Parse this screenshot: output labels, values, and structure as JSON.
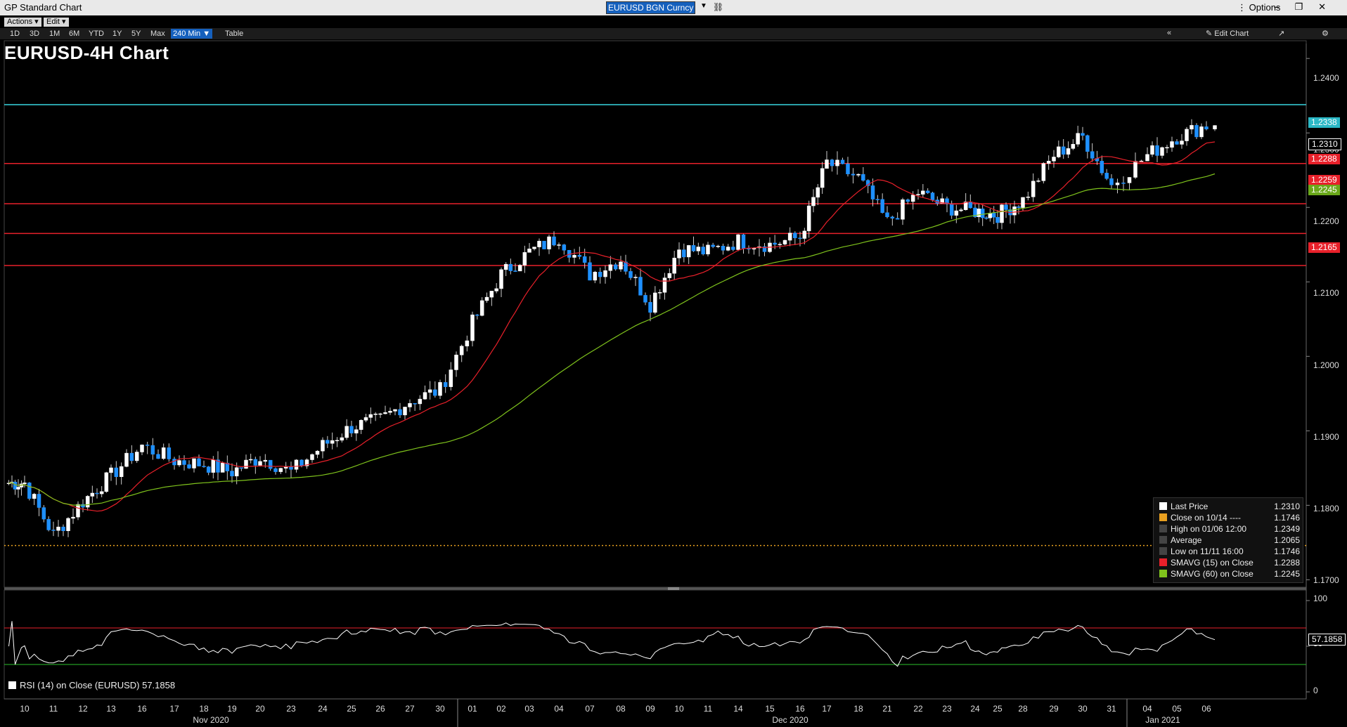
{
  "window": {
    "title": "GP Standard Chart",
    "ticker": "EURUSD BGN Curncy",
    "options_label": "Options"
  },
  "menubar": {
    "actions": "Actions",
    "edit": "Edit"
  },
  "toolbar": {
    "timeframes": [
      "1D",
      "3D",
      "1M",
      "6M",
      "YTD",
      "1Y",
      "5Y",
      "Max",
      "240 Min"
    ],
    "active_timeframe": "240 Min",
    "table": "Table",
    "edit_chart": "Edit Chart"
  },
  "chart_title": "EURUSD-4H Chart",
  "colors": {
    "up": "#ffffff",
    "down": "#1e90ff",
    "sma15": "#e8202a",
    "sma60": "#7fc31c",
    "cyan": "#38d6e0",
    "hline": "#e8202a",
    "rsi": "#ffffff",
    "low_dotted": "#e8a020"
  },
  "axis": {
    "price_ticks": [
      "1.2400",
      "1.2300",
      "1.2200",
      "1.2100",
      "1.2000",
      "1.1900",
      "1.1800",
      "1.1700"
    ],
    "rsi_ticks": [
      "100",
      "50",
      "0"
    ],
    "x_days": [
      "10",
      "11",
      "12",
      "13",
      "16",
      "17",
      "18",
      "19",
      "20",
      "23",
      "24",
      "25",
      "26",
      "27",
      "30",
      "01",
      "02",
      "03",
      "04",
      "07",
      "08",
      "09",
      "10",
      "11",
      "14",
      "15",
      "16",
      "17",
      "18",
      "21",
      "22",
      "23",
      "24",
      "25",
      "28",
      "29",
      "30",
      "31",
      "04",
      "05",
      "06"
    ],
    "month_labels": [
      "Nov 2020",
      "Dec 2020",
      "Jan 2021"
    ]
  },
  "price_tags": {
    "cyan": "1.2338",
    "last": "1.2310",
    "sma15": "1.2288",
    "red1": "1.2259",
    "sma60": "1.2245",
    "red3": "1.2165",
    "rsi_last": "57.1858"
  },
  "horizontal_lines": {
    "cyan": 1.2338,
    "red": [
      1.2259,
      1.2205,
      1.2165,
      1.2122
    ],
    "dotted_low": 1.1746
  },
  "legend": [
    {
      "label": "Last Price",
      "value": "1.2310",
      "color": "#ffffff"
    },
    {
      "label": "Close on 10/14 ----",
      "value": "1.1746",
      "color": "#e8a020"
    },
    {
      "label": "High on 01/06 12:00",
      "value": "1.2349",
      "color": "#444444"
    },
    {
      "label": "Average",
      "value": "1.2065",
      "color": "#444444"
    },
    {
      "label": "Low on 11/11 16:00",
      "value": "1.1746",
      "color": "#444444"
    },
    {
      "label": "SMAVG (15)  on Close",
      "value": "1.2288",
      "color": "#e8202a"
    },
    {
      "label": "SMAVG (60)  on Close",
      "value": "1.2245",
      "color": "#7fc31c"
    }
  ],
  "rsi_legend": "RSI (14)  on Close (EURUSD) 57.1858",
  "chart_data": {
    "type": "candlestick",
    "title": "EURUSD-4H Chart",
    "ylim": [
      1.169,
      1.242
    ],
    "series_close_anchors": [
      [
        "10",
        1.183
      ],
      [
        "11",
        1.176
      ],
      [
        "12",
        1.1805
      ],
      [
        "13",
        1.184
      ],
      [
        "16",
        1.188
      ],
      [
        "17",
        1.186
      ],
      [
        "18",
        1.1855
      ],
      [
        "19",
        1.1845
      ],
      [
        "20",
        1.1865
      ],
      [
        "23",
        1.1845
      ],
      [
        "24",
        1.188
      ],
      [
        "25",
        1.1905
      ],
      [
        "26",
        1.1915
      ],
      [
        "27",
        1.194
      ],
      [
        "30",
        1.1955
      ],
      [
        "01",
        1.2045
      ],
      [
        "02",
        1.211
      ],
      [
        "03",
        1.214
      ],
      [
        "04",
        1.216
      ],
      [
        "07",
        1.211
      ],
      [
        "08",
        1.213
      ],
      [
        "09",
        1.207
      ],
      [
        "10",
        1.2145
      ],
      [
        "11",
        1.214
      ],
      [
        "14",
        1.2155
      ],
      [
        "15",
        1.215
      ],
      [
        "16",
        1.216
      ],
      [
        "17",
        1.226
      ],
      [
        "18",
        1.224
      ],
      [
        "21",
        1.218
      ],
      [
        "22",
        1.222
      ],
      [
        "23",
        1.22
      ],
      [
        "24",
        1.2195
      ],
      [
        "25",
        1.219
      ],
      [
        "28",
        1.221
      ],
      [
        "29",
        1.227
      ],
      [
        "30",
        1.2295
      ],
      [
        "31",
        1.223
      ],
      [
        "04",
        1.227
      ],
      [
        "05",
        1.2295
      ],
      [
        "06",
        1.231
      ]
    ],
    "sma15_last": 1.2288,
    "sma60_last": 1.2245,
    "last_price": 1.231,
    "high": 1.2349,
    "low": 1.1746,
    "average": 1.2065,
    "rsi": {
      "period": 14,
      "last": 57.1858,
      "ylim": [
        0,
        100
      ],
      "bands": [
        70,
        30
      ]
    }
  }
}
